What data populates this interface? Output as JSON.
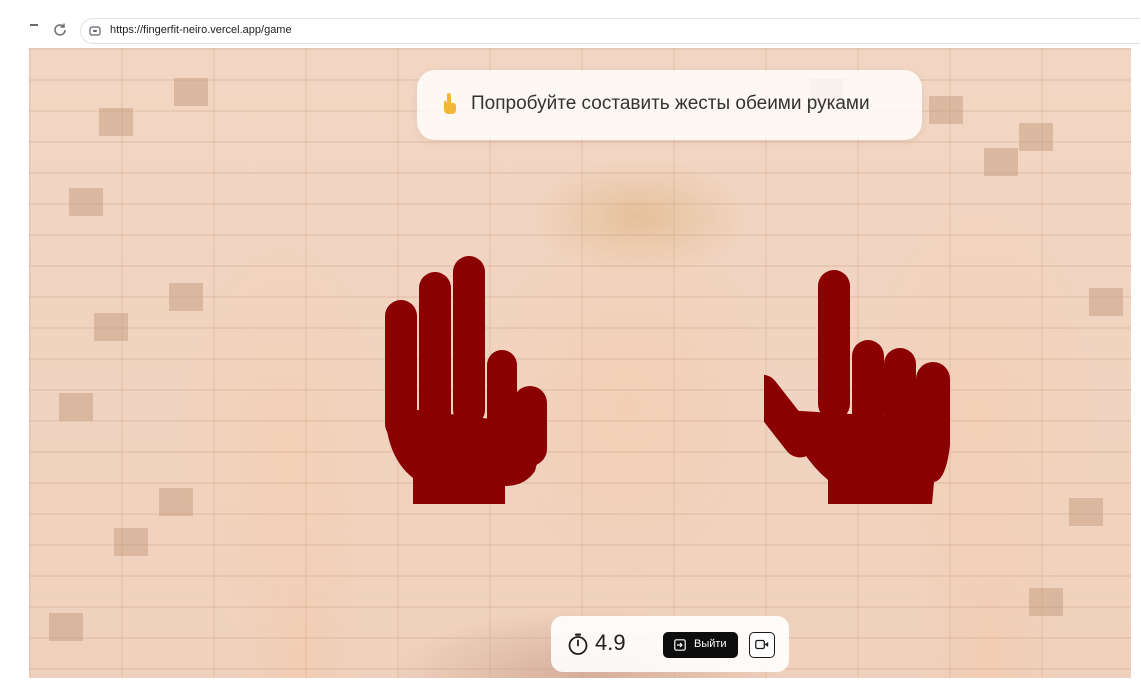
{
  "browser": {
    "url": "https://fingerfit-neiro.vercel.app/game"
  },
  "game": {
    "hint": {
      "icon": "pointing-hand-emoji",
      "text": "Попробуйте составить жесты обеими руками"
    },
    "gestures": {
      "left": "left-hand-three-fingers-icon",
      "right": "right-hand-index-pointing-icon",
      "color": "#8b0000"
    },
    "controls": {
      "timer_value": "4.9",
      "exit_label": "Выйти",
      "camera_icon": "camera-toggle-icon"
    }
  }
}
